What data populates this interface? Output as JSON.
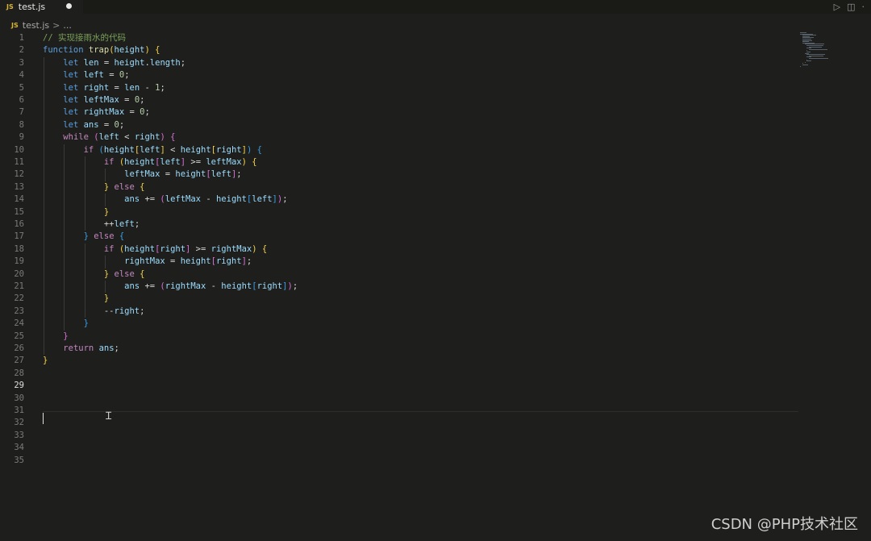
{
  "tab": {
    "badge": "JS",
    "title": "test.js"
  },
  "breadcrumb": {
    "badge": "JS",
    "file": "test.js",
    "sep": ">",
    "rest": "..."
  },
  "tab_actions": {
    "run": "▷",
    "split": "◫",
    "more": "·"
  },
  "editor": {
    "active_line": 29,
    "line_numbers": [
      "1",
      "2",
      "3",
      "4",
      "5",
      "6",
      "7",
      "8",
      "9",
      "10",
      "11",
      "12",
      "13",
      "14",
      "15",
      "16",
      "17",
      "18",
      "19",
      "20",
      "21",
      "22",
      "23",
      "24",
      "25",
      "26",
      "27",
      "28",
      "29",
      "30",
      "31",
      "32",
      "33",
      "34",
      "35"
    ],
    "lines": [
      [
        [
          "comment",
          "// 实现接雨水的代码"
        ]
      ],
      [
        [
          "kw",
          "function "
        ],
        [
          "fn",
          "trap"
        ],
        [
          "b1",
          "("
        ],
        [
          "var",
          "height"
        ],
        [
          "b1",
          ")"
        ],
        [
          "op",
          " "
        ],
        [
          "b1",
          "{"
        ]
      ],
      [
        [
          "op",
          "    "
        ],
        [
          "kw",
          "let "
        ],
        [
          "var",
          "len"
        ],
        [
          "op",
          " = "
        ],
        [
          "var",
          "height"
        ],
        [
          "op",
          "."
        ],
        [
          "var",
          "length"
        ],
        [
          "op",
          ";"
        ]
      ],
      [
        [
          "op",
          "    "
        ],
        [
          "kw",
          "let "
        ],
        [
          "var",
          "left"
        ],
        [
          "op",
          " = "
        ],
        [
          "num",
          "0"
        ],
        [
          "op",
          ";"
        ]
      ],
      [
        [
          "op",
          "    "
        ],
        [
          "kw",
          "let "
        ],
        [
          "var",
          "right"
        ],
        [
          "op",
          " = "
        ],
        [
          "var",
          "len"
        ],
        [
          "op",
          " - "
        ],
        [
          "num",
          "1"
        ],
        [
          "op",
          ";"
        ]
      ],
      [
        [
          "op",
          "    "
        ],
        [
          "kw",
          "let "
        ],
        [
          "var",
          "leftMax"
        ],
        [
          "op",
          " = "
        ],
        [
          "num",
          "0"
        ],
        [
          "op",
          ";"
        ]
      ],
      [
        [
          "op",
          "    "
        ],
        [
          "kw",
          "let "
        ],
        [
          "var",
          "rightMax"
        ],
        [
          "op",
          " = "
        ],
        [
          "num",
          "0"
        ],
        [
          "op",
          ";"
        ]
      ],
      [
        [
          "op",
          "    "
        ],
        [
          "kw",
          "let "
        ],
        [
          "var",
          "ans"
        ],
        [
          "op",
          " = "
        ],
        [
          "num",
          "0"
        ],
        [
          "op",
          ";"
        ]
      ],
      [
        [
          "op",
          "    "
        ],
        [
          "ctl",
          "while "
        ],
        [
          "b2",
          "("
        ],
        [
          "var",
          "left"
        ],
        [
          "op",
          " < "
        ],
        [
          "var",
          "right"
        ],
        [
          "b2",
          ")"
        ],
        [
          "op",
          " "
        ],
        [
          "b2",
          "{"
        ]
      ],
      [
        [
          "op",
          "        "
        ],
        [
          "ctl",
          "if "
        ],
        [
          "b3",
          "("
        ],
        [
          "var",
          "height"
        ],
        [
          "b1",
          "["
        ],
        [
          "var",
          "left"
        ],
        [
          "b1",
          "]"
        ],
        [
          "op",
          " < "
        ],
        [
          "var",
          "height"
        ],
        [
          "b1",
          "["
        ],
        [
          "var",
          "right"
        ],
        [
          "b1",
          "]"
        ],
        [
          "b3",
          ")"
        ],
        [
          "op",
          " "
        ],
        [
          "b3",
          "{"
        ]
      ],
      [
        [
          "op",
          "            "
        ],
        [
          "ctl",
          "if "
        ],
        [
          "b1",
          "("
        ],
        [
          "var",
          "height"
        ],
        [
          "b2",
          "["
        ],
        [
          "var",
          "left"
        ],
        [
          "b2",
          "]"
        ],
        [
          "op",
          " >= "
        ],
        [
          "var",
          "leftMax"
        ],
        [
          "b1",
          ")"
        ],
        [
          "op",
          " "
        ],
        [
          "b1",
          "{"
        ]
      ],
      [
        [
          "op",
          "                "
        ],
        [
          "var",
          "leftMax"
        ],
        [
          "op",
          " = "
        ],
        [
          "var",
          "height"
        ],
        [
          "b2",
          "["
        ],
        [
          "var",
          "left"
        ],
        [
          "b2",
          "]"
        ],
        [
          "op",
          ";"
        ]
      ],
      [
        [
          "op",
          "            "
        ],
        [
          "b1",
          "}"
        ],
        [
          "ctl",
          " else "
        ],
        [
          "b1",
          "{"
        ]
      ],
      [
        [
          "op",
          "                "
        ],
        [
          "var",
          "ans"
        ],
        [
          "op",
          " += "
        ],
        [
          "b2",
          "("
        ],
        [
          "var",
          "leftMax"
        ],
        [
          "op",
          " - "
        ],
        [
          "var",
          "height"
        ],
        [
          "b3",
          "["
        ],
        [
          "var",
          "left"
        ],
        [
          "b3",
          "]"
        ],
        [
          "b2",
          ")"
        ],
        [
          "op",
          ";"
        ]
      ],
      [
        [
          "op",
          "            "
        ],
        [
          "b1",
          "}"
        ]
      ],
      [
        [
          "op",
          "            "
        ],
        [
          "op",
          "++"
        ],
        [
          "var",
          "left"
        ],
        [
          "op",
          ";"
        ]
      ],
      [
        [
          "op",
          "        "
        ],
        [
          "b3",
          "}"
        ],
        [
          "ctl",
          " else "
        ],
        [
          "b3",
          "{"
        ]
      ],
      [
        [
          "op",
          "            "
        ],
        [
          "ctl",
          "if "
        ],
        [
          "b1",
          "("
        ],
        [
          "var",
          "height"
        ],
        [
          "b2",
          "["
        ],
        [
          "var",
          "right"
        ],
        [
          "b2",
          "]"
        ],
        [
          "op",
          " >= "
        ],
        [
          "var",
          "rightMax"
        ],
        [
          "b1",
          ")"
        ],
        [
          "op",
          " "
        ],
        [
          "b1",
          "{"
        ]
      ],
      [
        [
          "op",
          "                "
        ],
        [
          "var",
          "rightMax"
        ],
        [
          "op",
          " = "
        ],
        [
          "var",
          "height"
        ],
        [
          "b2",
          "["
        ],
        [
          "var",
          "right"
        ],
        [
          "b2",
          "]"
        ],
        [
          "op",
          ";"
        ]
      ],
      [
        [
          "op",
          "            "
        ],
        [
          "b1",
          "}"
        ],
        [
          "ctl",
          " else "
        ],
        [
          "b1",
          "{"
        ]
      ],
      [
        [
          "op",
          "                "
        ],
        [
          "var",
          "ans"
        ],
        [
          "op",
          " += "
        ],
        [
          "b2",
          "("
        ],
        [
          "var",
          "rightMax"
        ],
        [
          "op",
          " - "
        ],
        [
          "var",
          "height"
        ],
        [
          "b3",
          "["
        ],
        [
          "var",
          "right"
        ],
        [
          "b3",
          "]"
        ],
        [
          "b2",
          ")"
        ],
        [
          "op",
          ";"
        ]
      ],
      [
        [
          "op",
          "            "
        ],
        [
          "b1",
          "}"
        ]
      ],
      [
        [
          "op",
          "            "
        ],
        [
          "op",
          "--"
        ],
        [
          "var",
          "right"
        ],
        [
          "op",
          ";"
        ]
      ],
      [
        [
          "op",
          "        "
        ],
        [
          "b3",
          "}"
        ]
      ],
      [
        [
          "op",
          "    "
        ],
        [
          "b2",
          "}"
        ]
      ],
      [
        [
          "op",
          "    "
        ],
        [
          "ctl",
          "return "
        ],
        [
          "var",
          "ans"
        ],
        [
          "op",
          ";"
        ]
      ],
      [
        [
          "b1",
          "}"
        ]
      ],
      [],
      [],
      [],
      [],
      [],
      [],
      [],
      []
    ]
  },
  "colors": {
    "background": "#1e1f1c",
    "comment": "#7aa05a",
    "keyword": "#5b9ee0",
    "control": "#c586c0",
    "function": "#dcdcaa",
    "variable": "#9cdcfe",
    "number": "#b5cea8"
  },
  "icons": {
    "js_file": "js-file-icon",
    "text_cursor": "ibeam-cursor-icon"
  },
  "watermark": "CSDN @PHP技术社区"
}
